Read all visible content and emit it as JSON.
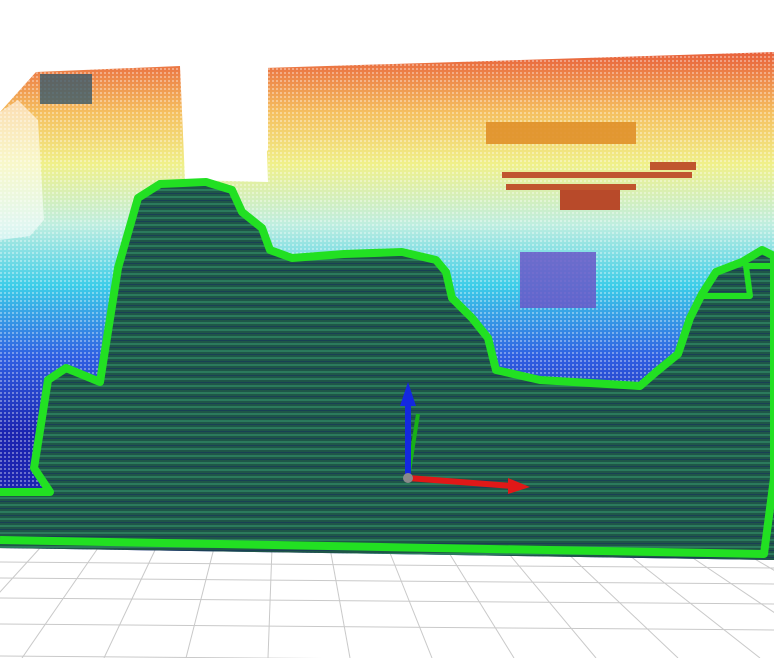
{
  "viewer": {
    "background_color": "#ffffff",
    "ground_grid": {
      "visible": true,
      "line_color": "#c9c9c9"
    },
    "point_cloud": {
      "visible": true,
      "colormap": [
        "#1a22a8",
        "#2a55e0",
        "#26c2e8",
        "#aee8e0",
        "#f4ec7a",
        "#f5a24a",
        "#e05a35"
      ],
      "floor_color": "#1f5a4a",
      "floor_stripe_color": "#2a7a5a"
    },
    "obstacles": [
      {
        "kind": "horizontal-bar",
        "color": "#e0902a"
      },
      {
        "kind": "shelf-structure",
        "color": "#c0562e"
      },
      {
        "kind": "low-block",
        "color": "#6a58c8"
      },
      {
        "kind": "upper-left-patch",
        "color": "#3a5a6a"
      }
    ],
    "boundary_outline": {
      "visible": true,
      "color": "#22e022"
    },
    "axes": {
      "visible": true,
      "x_color": "#e01818",
      "y_color": "#18b018",
      "z_color": "#1428e0",
      "origin_color": "#8a8a8a"
    }
  }
}
